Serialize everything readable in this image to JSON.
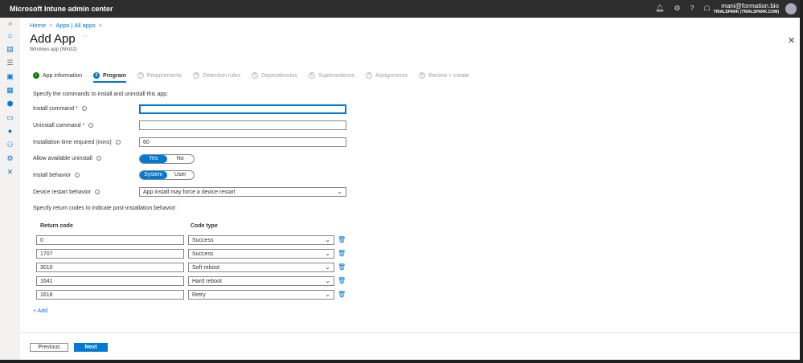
{
  "header": {
    "title": "Microsoft Intune admin center",
    "user_email": "mani@formation.bio",
    "tenant": "TRIALSPARK (TRIALSPARK.COM)"
  },
  "breadcrumb": [
    "Home",
    "Apps | All apps"
  ],
  "page": {
    "title": "Add App",
    "more": "···",
    "subtitle": "Windows app (Win32)",
    "close": "✕"
  },
  "steps": [
    {
      "num": "✓",
      "label": "App information"
    },
    {
      "num": "2",
      "label": "Program"
    },
    {
      "num": "3",
      "label": "Requirements"
    },
    {
      "num": "4",
      "label": "Detection rules"
    },
    {
      "num": "5",
      "label": "Dependencies"
    },
    {
      "num": "6",
      "label": "Supersedence"
    },
    {
      "num": "7",
      "label": "Assignments"
    },
    {
      "num": "8",
      "label": "Review + create"
    }
  ],
  "form": {
    "intro": "Specify the commands to install and uninstall this app:",
    "install_command": {
      "label": "Install command",
      "value": ""
    },
    "uninstall_command": {
      "label": "Uninstall command",
      "value": ""
    },
    "install_time": {
      "label": "Installation time required (mins)",
      "value": "60"
    },
    "allow_uninstall": {
      "label": "Allow available uninstall",
      "yes": "Yes",
      "no": "No",
      "selected": "Yes"
    },
    "install_behavior": {
      "label": "Install behavior",
      "system": "System",
      "user": "User",
      "selected": "System"
    },
    "restart": {
      "label": "Device restart behavior",
      "value": "App install may force a device restart"
    },
    "return_intro": "Specify return codes to indicate post-installation behavior:",
    "col_return": "Return code",
    "col_type": "Code type",
    "return_codes": [
      {
        "code": "0",
        "type": "Success"
      },
      {
        "code": "1707",
        "type": "Success"
      },
      {
        "code": "3010",
        "type": "Soft reboot"
      },
      {
        "code": "1641",
        "type": "Hard reboot"
      },
      {
        "code": "1618",
        "type": "Retry"
      }
    ],
    "add": "+ Add"
  },
  "footer": {
    "previous": "Previous",
    "next": "Next"
  }
}
